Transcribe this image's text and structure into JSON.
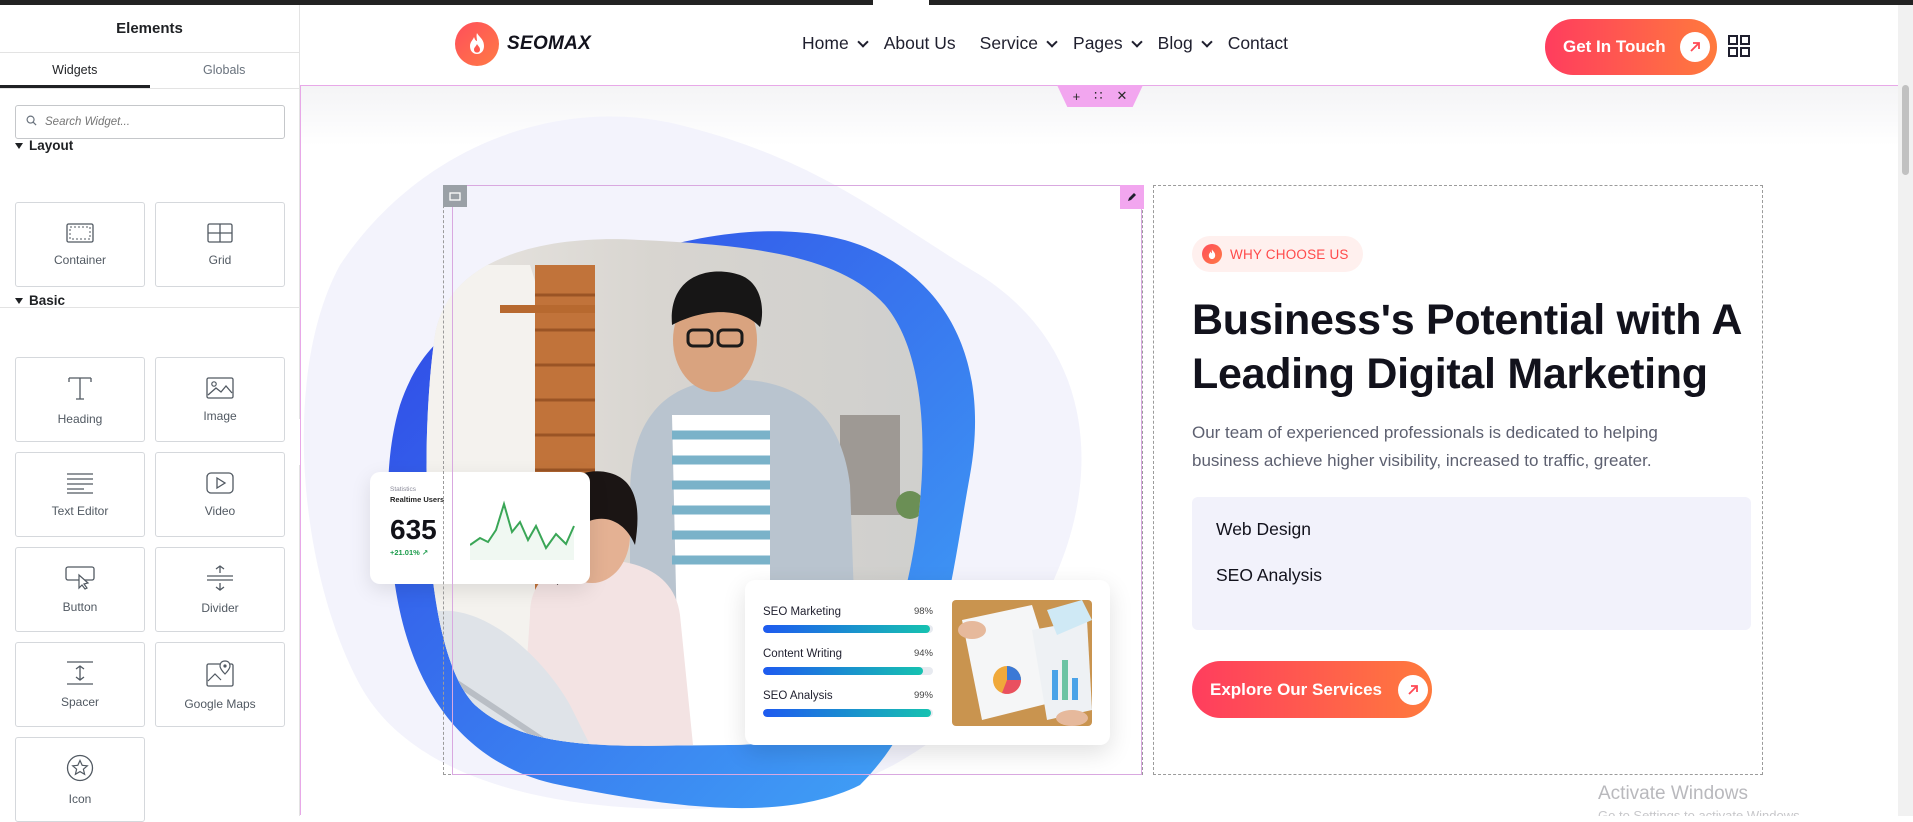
{
  "panel": {
    "title": "Elements",
    "tabs": [
      {
        "label": "Widgets",
        "active": true
      },
      {
        "label": "Globals",
        "active": false
      }
    ],
    "search_placeholder": "Search Widget...",
    "sections": [
      {
        "label": "Layout",
        "widgets": [
          {
            "label": "Container",
            "icon": "container-icon"
          },
          {
            "label": "Grid",
            "icon": "grid-layout-icon"
          }
        ]
      },
      {
        "label": "Basic",
        "widgets": [
          {
            "label": "Heading",
            "icon": "heading-icon"
          },
          {
            "label": "Image",
            "icon": "image-icon"
          },
          {
            "label": "Text Editor",
            "icon": "text-editor-icon"
          },
          {
            "label": "Video",
            "icon": "video-icon"
          },
          {
            "label": "Button",
            "icon": "button-icon"
          },
          {
            "label": "Divider",
            "icon": "divider-icon"
          },
          {
            "label": "Spacer",
            "icon": "spacer-icon"
          },
          {
            "label": "Google Maps",
            "icon": "google-maps-icon"
          },
          {
            "label": "Icon",
            "icon": "star-icon"
          }
        ]
      }
    ]
  },
  "site": {
    "brand": "SEOMAX",
    "nav": [
      {
        "label": "Home",
        "dropdown": true
      },
      {
        "label": "About Us",
        "dropdown": false
      },
      {
        "label": "Service",
        "dropdown": true
      },
      {
        "label": "Pages",
        "dropdown": true
      },
      {
        "label": "Blog",
        "dropdown": true
      },
      {
        "label": "Contact",
        "dropdown": false
      }
    ],
    "cta_label": "Get In Touch",
    "accent_start": "#ff3d5e",
    "accent_end": "#ff7a3d"
  },
  "hero": {
    "badge": "WHY CHOOSE US",
    "title": "Business's Potential with A Leading Digital Marketing",
    "description": "Our team of experienced professionals is dedicated to helping business achieve higher visibility, increased to traffic, greater.",
    "services": [
      "Web Design",
      "SEO Analysis"
    ],
    "button_label": "Explore Our Services",
    "stat_card": {
      "label": "Statistics",
      "title": "Realtime Users",
      "value": "635",
      "change": "+21.01%"
    },
    "skills": [
      {
        "label": "SEO Marketing",
        "percent_text": "98%",
        "percent": 98
      },
      {
        "label": "Content Writing",
        "percent_text": "94%",
        "percent": 94
      },
      {
        "label": "SEO Analysis",
        "percent_text": "99%",
        "percent": 99
      }
    ]
  },
  "os_watermark": {
    "title": "Activate Windows",
    "subtitle": "Go to Settings to activate Windows."
  }
}
